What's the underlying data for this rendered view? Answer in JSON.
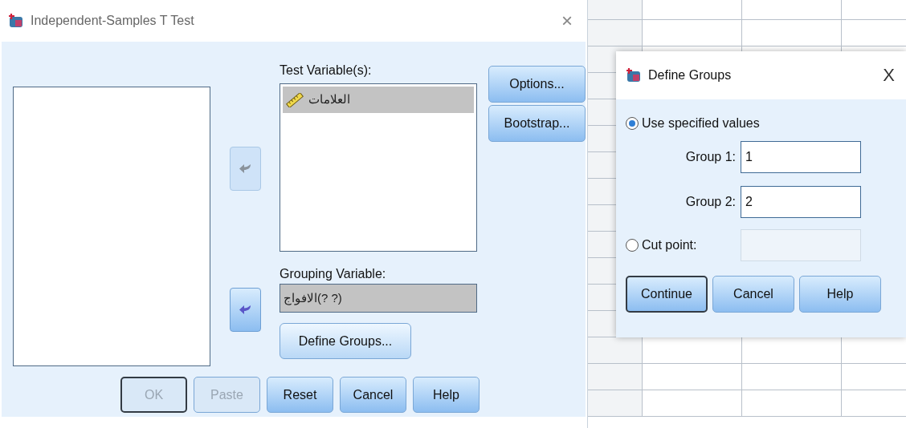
{
  "main_dialog": {
    "title": "Independent-Samples T Test",
    "close": "×",
    "move_buttons": [
      {
        "disabled": true
      },
      {
        "disabled": false
      }
    ],
    "test_variables": {
      "label": "Test Variable(s):",
      "items": [
        {
          "name": "العلامات",
          "selected": true
        }
      ]
    },
    "side_buttons": [
      {
        "label": "Options...",
        "disabled": false
      },
      {
        "label": "Bootstrap...",
        "disabled": false
      }
    ],
    "grouping_variable": {
      "label": "Grouping Variable:",
      "value": "الافواج(? ?)",
      "selected": true
    },
    "define_groups_button": "Define Groups...",
    "buttons": [
      {
        "label": "OK",
        "disabled": true,
        "default": true
      },
      {
        "label": "Paste",
        "disabled": true,
        "default": false
      },
      {
        "label": "Reset",
        "disabled": false,
        "default": false
      },
      {
        "label": "Cancel",
        "disabled": false,
        "default": false
      },
      {
        "label": "Help",
        "disabled": false,
        "default": false
      }
    ]
  },
  "define_groups_dialog": {
    "title": "Define Groups",
    "close": "X",
    "options": [
      {
        "label": "Use specified values",
        "selected": true
      },
      {
        "label": "Cut point:",
        "selected": false
      }
    ],
    "groups": [
      {
        "label": "Group 1:",
        "value": "1"
      },
      {
        "label": "Group 2:",
        "value": "2"
      }
    ],
    "buttons": [
      {
        "label": "Continue",
        "default": true
      },
      {
        "label": "Cancel",
        "default": false
      },
      {
        "label": "Help",
        "default": false
      }
    ]
  }
}
